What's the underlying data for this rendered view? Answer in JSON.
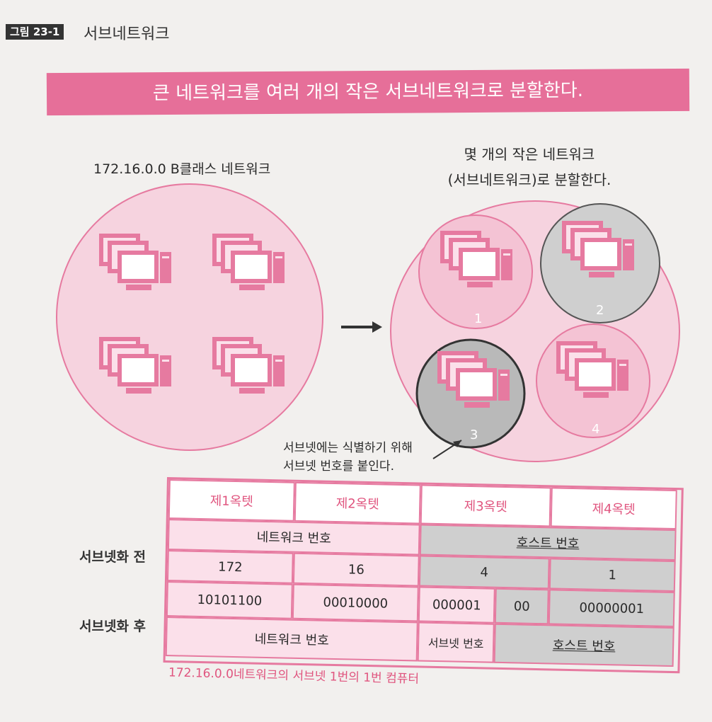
{
  "figure": {
    "label": "그림 23-1",
    "title": "서브네트워크"
  },
  "banner": "큰 네트워크를 여러 개의 작은 서브네트워크로 분할한다.",
  "left_caption": "172.16.0.0 B클래스 네트워크",
  "right_caption": {
    "line1": "몇 개의 작은 네트워크",
    "line2": "(서브네트워크)로 분할한다."
  },
  "subnets": [
    "1",
    "2",
    "3",
    "4"
  ],
  "note": {
    "line1": "서브넷에는 식별하기 위해",
    "line2": "서브넷 번호를 붙인다."
  },
  "table": {
    "headers": [
      "제1옥텟",
      "제2옥텟",
      "제3옥텟",
      "제4옥텟"
    ],
    "before_label": "서브넷화 전",
    "after_label": "서브넷화 후",
    "network_number": "네트워크 번호",
    "host_number": "호스트 번호",
    "subnet_number": "서브넷 번호",
    "decimal": [
      "172",
      "16",
      "4",
      "1"
    ],
    "binary": [
      "10101100",
      "00010000",
      "000001",
      "00",
      "00000001"
    ]
  },
  "footnote": "172.16.0.0네트워크의 서브넷 1번의 1번 컴퓨터",
  "colors": {
    "pink": "#e66f99",
    "light_pink": "#fbe0ea",
    "gray": "#cfcfcf"
  }
}
